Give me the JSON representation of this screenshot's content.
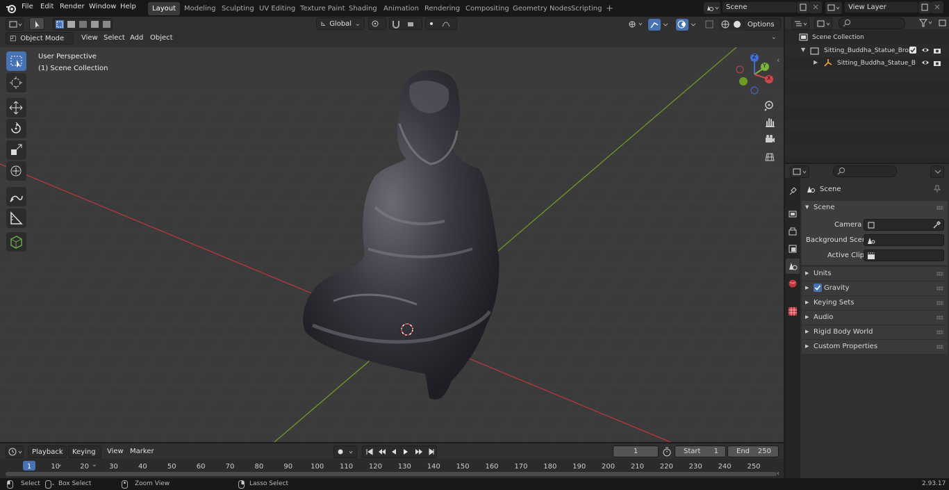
{
  "topbar": {
    "menus": [
      "File",
      "Edit",
      "Render",
      "Window",
      "Help"
    ],
    "workspaces": [
      "Layout",
      "Modeling",
      "Sculpting",
      "UV Editing",
      "Texture Paint",
      "Shading",
      "Animation",
      "Rendering",
      "Compositing",
      "Geometry Nodes",
      "Scripting"
    ],
    "active_workspace": "Layout",
    "add_tab": "+",
    "scene": "Scene",
    "view_layer": "View Layer"
  },
  "viewport_header": {
    "mode": "Object Mode",
    "menus": [
      "View",
      "Select",
      "Add",
      "Object"
    ],
    "transform_orientation": "Global",
    "options": "Options"
  },
  "viewport": {
    "overlay_line1": "User Perspective",
    "overlay_line2": "(1) Scene Collection",
    "gizmo": {
      "z": "Z",
      "y": "Y",
      "x": "X"
    }
  },
  "outliner": {
    "root": "Scene Collection",
    "items": [
      {
        "label": "Sitting_Buddha_Statue_Bronz",
        "type": "collection"
      },
      {
        "label": "Sitting_Buddha_Statue_B",
        "type": "object"
      }
    ]
  },
  "properties": {
    "context": "Scene",
    "panel": "Scene",
    "fields": [
      {
        "label": "Camera",
        "value": ""
      },
      {
        "label": "Background Scene",
        "value": ""
      },
      {
        "label": "Active Clip",
        "value": ""
      }
    ],
    "sections": [
      "Units",
      "Gravity",
      "Keying Sets",
      "Audio",
      "Rigid Body World",
      "Custom Properties"
    ],
    "gravity_checked": true
  },
  "timeline": {
    "menus": [
      "Playback",
      "Keying",
      "View",
      "Marker"
    ],
    "current_frame": "1",
    "start_label": "Start",
    "start": "1",
    "end_label": "End",
    "end": "250",
    "ruler": [
      "1",
      "10",
      "20",
      "30",
      "40",
      "50",
      "60",
      "70",
      "80",
      "90",
      "100",
      "110",
      "120",
      "130",
      "140",
      "150",
      "160",
      "170",
      "180",
      "190",
      "200",
      "210",
      "220",
      "230",
      "240",
      "250"
    ]
  },
  "statusbar": {
    "items": [
      "Select",
      "Box Select",
      "Zoom View",
      "Lasso Select"
    ],
    "version": "2.93.17"
  },
  "colors": {
    "accent": "#4772b3",
    "x_axis": "#c53a3f",
    "y_axis": "#6d9b25",
    "header": "#303030"
  }
}
